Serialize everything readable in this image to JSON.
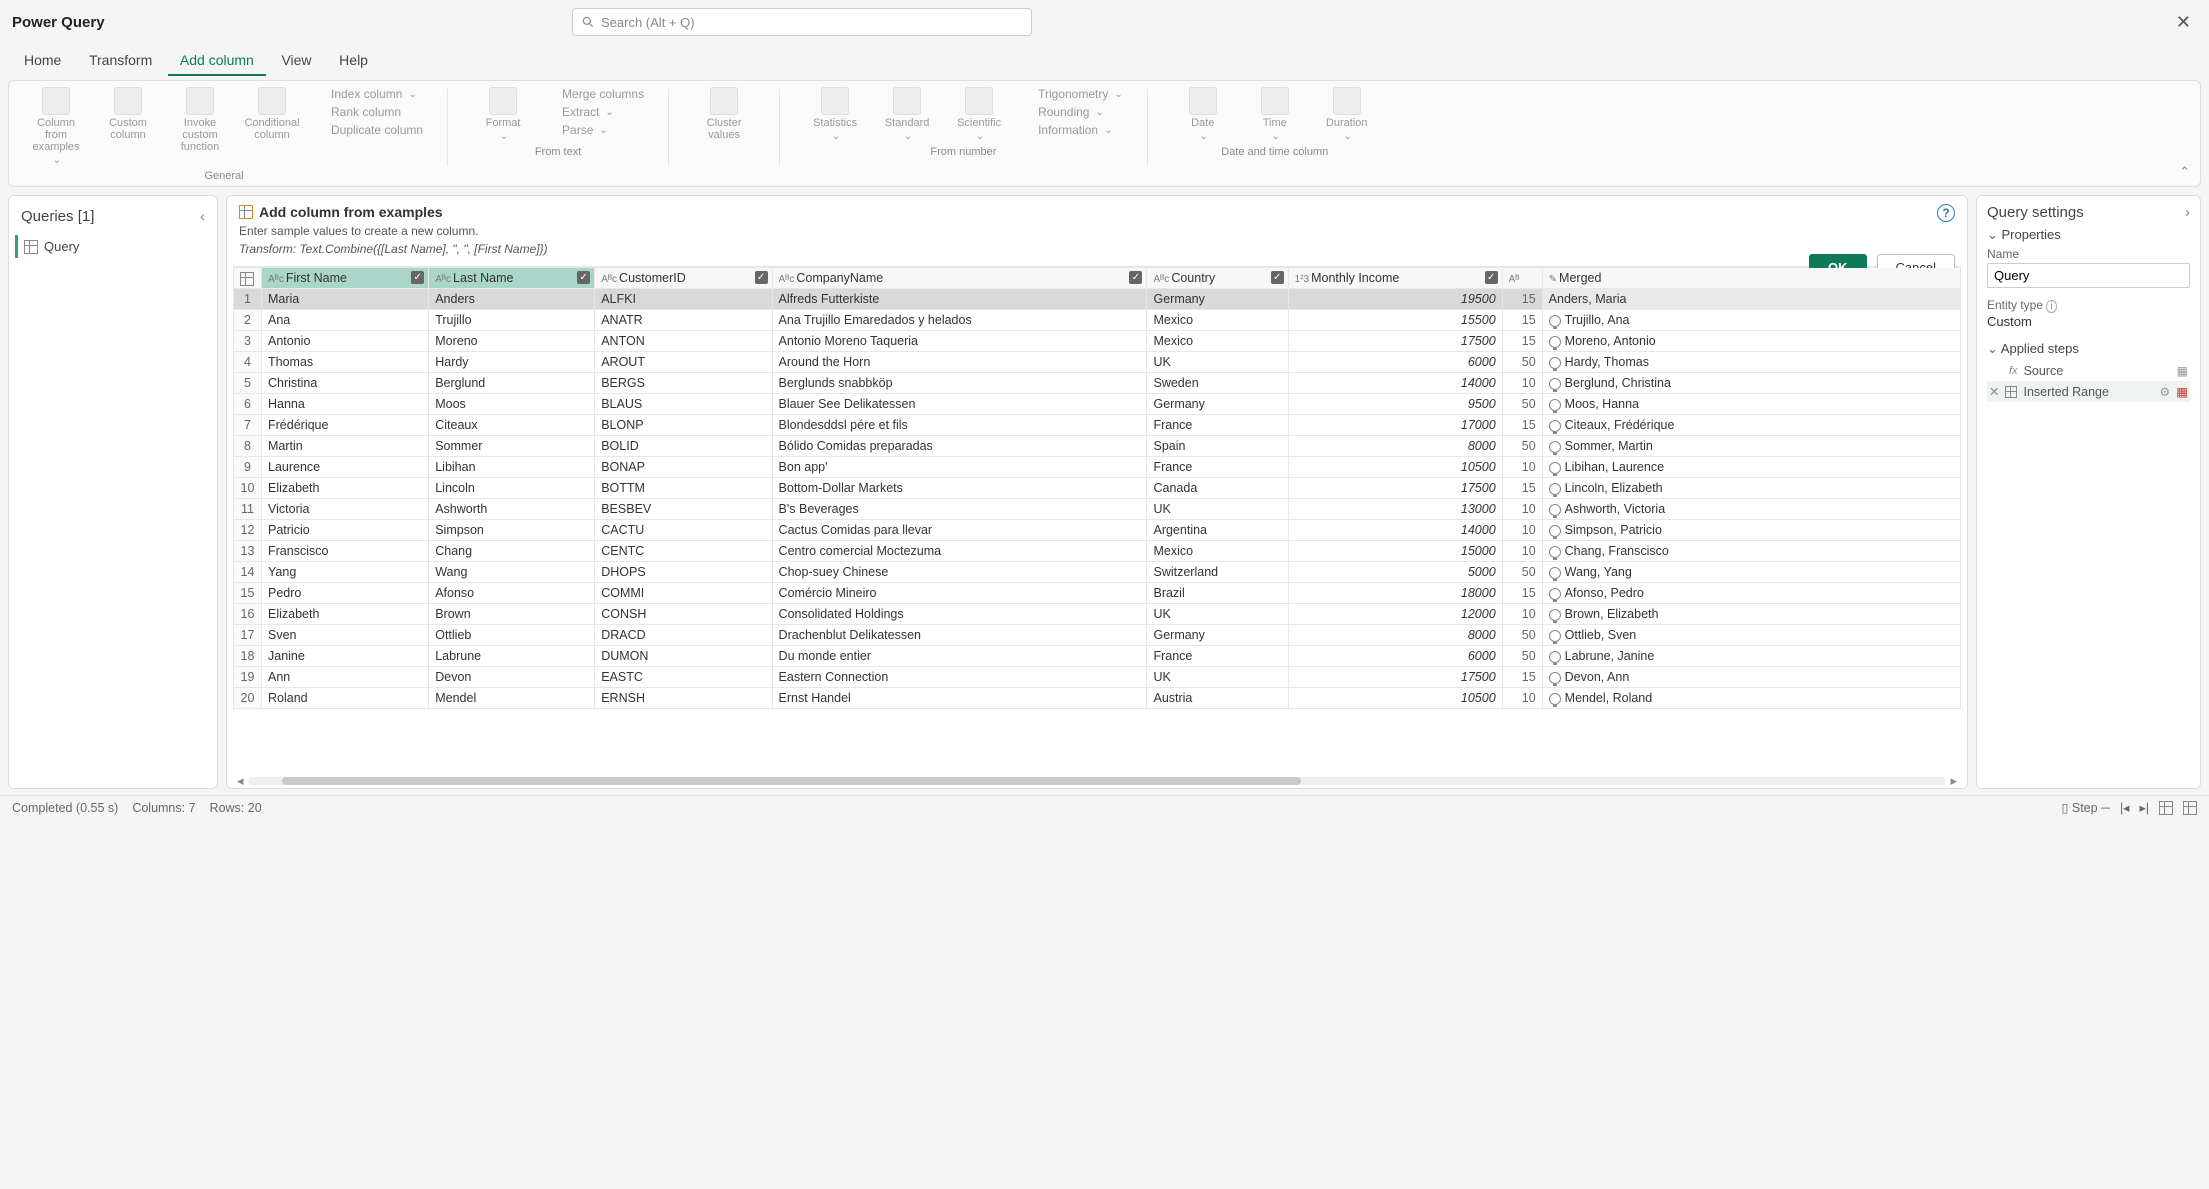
{
  "app": {
    "title": "Power Query",
    "search_placeholder": "Search (Alt + Q)"
  },
  "tabs": {
    "home": "Home",
    "transform": "Transform",
    "add_column": "Add column",
    "view": "View",
    "help": "Help"
  },
  "ribbon": {
    "group_general": "General",
    "group_from_text": "From text",
    "group_from_number": "From number",
    "group_datetime": "Date and time column",
    "col_from_examples": "Column from examples",
    "custom_column": "Custom column",
    "invoke_custom": "Invoke custom function",
    "conditional": "Conditional column",
    "index_col": "Index column",
    "rank_col": "Rank column",
    "duplicate_col": "Duplicate column",
    "format": "Format",
    "merge_cols": "Merge columns",
    "extract": "Extract",
    "parse": "Parse",
    "cluster": "Cluster values",
    "statistics": "Statistics",
    "standard": "Standard",
    "scientific": "Scientific",
    "trig": "Trigonometry",
    "rounding": "Rounding",
    "information": "Information",
    "date": "Date",
    "time": "Time",
    "duration": "Duration"
  },
  "queries": {
    "title": "Queries [1]",
    "item1": "Query"
  },
  "banner": {
    "title": "Add column from examples",
    "subtitle": "Enter sample values to create a new column.",
    "transform": "Transform: Text.Combine({[Last Name], \", \", [First Name]})",
    "ok": "OK",
    "cancel": "Cancel"
  },
  "columns": {
    "first_name": "First Name",
    "last_name": "Last Name",
    "customer_id": "CustomerID",
    "company_name": "CompanyName",
    "country": "Country",
    "monthly_income": "Monthly Income",
    "merged": "Merged"
  },
  "rows": [
    {
      "n": "1",
      "fn": "Maria",
      "ln": "Anders",
      "cid": "ALFKI",
      "co": "Alfreds Futterkiste",
      "ct": "Germany",
      "inc": "19500",
      "p": "15",
      "m": "Anders, Maria"
    },
    {
      "n": "2",
      "fn": "Ana",
      "ln": "Trujillo",
      "cid": "ANATR",
      "co": "Ana Trujillo Emaredados y helados",
      "ct": "Mexico",
      "inc": "15500",
      "p": "15",
      "m": "Trujillo, Ana"
    },
    {
      "n": "3",
      "fn": "Antonio",
      "ln": "Moreno",
      "cid": "ANTON",
      "co": "Antonio Moreno Taqueria",
      "ct": "Mexico",
      "inc": "17500",
      "p": "15",
      "m": "Moreno, Antonio"
    },
    {
      "n": "4",
      "fn": "Thomas",
      "ln": "Hardy",
      "cid": "AROUT",
      "co": "Around the Horn",
      "ct": "UK",
      "inc": "6000",
      "p": "50",
      "m": "Hardy, Thomas"
    },
    {
      "n": "5",
      "fn": "Christina",
      "ln": "Berglund",
      "cid": "BERGS",
      "co": "Berglunds snabbköp",
      "ct": "Sweden",
      "inc": "14000",
      "p": "10",
      "m": "Berglund, Christina"
    },
    {
      "n": "6",
      "fn": "Hanna",
      "ln": "Moos",
      "cid": "BLAUS",
      "co": "Blauer See Delikatessen",
      "ct": "Germany",
      "inc": "9500",
      "p": "50",
      "m": "Moos, Hanna"
    },
    {
      "n": "7",
      "fn": "Frédérique",
      "ln": "Citeaux",
      "cid": "BLONP",
      "co": "Blondesddsl pére et fils",
      "ct": "France",
      "inc": "17000",
      "p": "15",
      "m": "Citeaux, Frédérique"
    },
    {
      "n": "8",
      "fn": "Martin",
      "ln": "Sommer",
      "cid": "BOLID",
      "co": "Bólido Comidas preparadas",
      "ct": "Spain",
      "inc": "8000",
      "p": "50",
      "m": "Sommer, Martin"
    },
    {
      "n": "9",
      "fn": "Laurence",
      "ln": "Libihan",
      "cid": "BONAP",
      "co": "Bon app'",
      "ct": "France",
      "inc": "10500",
      "p": "10",
      "m": "Libihan, Laurence"
    },
    {
      "n": "10",
      "fn": "Elizabeth",
      "ln": "Lincoln",
      "cid": "BOTTM",
      "co": "Bottom-Dollar Markets",
      "ct": "Canada",
      "inc": "17500",
      "p": "15",
      "m": "Lincoln, Elizabeth"
    },
    {
      "n": "11",
      "fn": "Victoria",
      "ln": "Ashworth",
      "cid": "BESBEV",
      "co": "B's Beverages",
      "ct": "UK",
      "inc": "13000",
      "p": "10",
      "m": "Ashworth, Victoria"
    },
    {
      "n": "12",
      "fn": "Patricio",
      "ln": "Simpson",
      "cid": "CACTU",
      "co": "Cactus Comidas para llevar",
      "ct": "Argentina",
      "inc": "14000",
      "p": "10",
      "m": "Simpson, Patricio"
    },
    {
      "n": "13",
      "fn": "Franscisco",
      "ln": "Chang",
      "cid": "CENTC",
      "co": "Centro comercial Moctezuma",
      "ct": "Mexico",
      "inc": "15000",
      "p": "10",
      "m": "Chang, Franscisco"
    },
    {
      "n": "14",
      "fn": "Yang",
      "ln": "Wang",
      "cid": "DHOPS",
      "co": "Chop-suey Chinese",
      "ct": "Switzerland",
      "inc": "5000",
      "p": "50",
      "m": "Wang, Yang"
    },
    {
      "n": "15",
      "fn": "Pedro",
      "ln": "Afonso",
      "cid": "COMMI",
      "co": "Comércio Mineiro",
      "ct": "Brazil",
      "inc": "18000",
      "p": "15",
      "m": "Afonso, Pedro"
    },
    {
      "n": "16",
      "fn": "Elizabeth",
      "ln": "Brown",
      "cid": "CONSH",
      "co": "Consolidated Holdings",
      "ct": "UK",
      "inc": "12000",
      "p": "10",
      "m": "Brown, Elizabeth"
    },
    {
      "n": "17",
      "fn": "Sven",
      "ln": "Ottlieb",
      "cid": "DRACD",
      "co": "Drachenblut Delikatessen",
      "ct": "Germany",
      "inc": "8000",
      "p": "50",
      "m": "Ottlieb, Sven"
    },
    {
      "n": "18",
      "fn": "Janine",
      "ln": "Labrune",
      "cid": "DUMON",
      "co": "Du monde entier",
      "ct": "France",
      "inc": "6000",
      "p": "50",
      "m": "Labrune, Janine"
    },
    {
      "n": "19",
      "fn": "Ann",
      "ln": "Devon",
      "cid": "EASTC",
      "co": "Eastern Connection",
      "ct": "UK",
      "inc": "17500",
      "p": "15",
      "m": "Devon, Ann"
    },
    {
      "n": "20",
      "fn": "Roland",
      "ln": "Mendel",
      "cid": "ERNSH",
      "co": "Ernst Handel",
      "ct": "Austria",
      "inc": "10500",
      "p": "10",
      "m": "Mendel, Roland"
    }
  ],
  "settings": {
    "title": "Query settings",
    "properties": "Properties",
    "name_label": "Name",
    "name_value": "Query",
    "entity_label": "Entity type",
    "entity_value": "Custom",
    "applied_steps": "Applied steps",
    "step_source": "Source",
    "step_inserted": "Inserted Range"
  },
  "status": {
    "completed": "Completed (0.55 s)",
    "columns": "Columns: 7",
    "rows": "Rows: 20",
    "step": "Step"
  }
}
